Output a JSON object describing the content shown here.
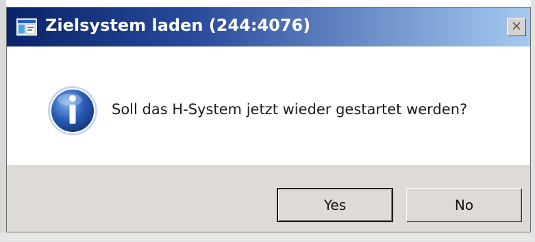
{
  "dialog": {
    "title": "Zielsystem laden (244:4076)",
    "message": "Soll das H-System jetzt wieder gestartet werden?",
    "icons": {
      "app": "application-window-icon",
      "close": "close-icon",
      "info": "information-icon"
    },
    "buttons": {
      "yes_label": "Yes",
      "no_label": "No"
    }
  },
  "colors": {
    "titlebar_start": "#0a246a",
    "titlebar_end": "#a6caf0",
    "button_bar": "#dedbd6",
    "info_icon_blue": "#2a5fb8"
  }
}
